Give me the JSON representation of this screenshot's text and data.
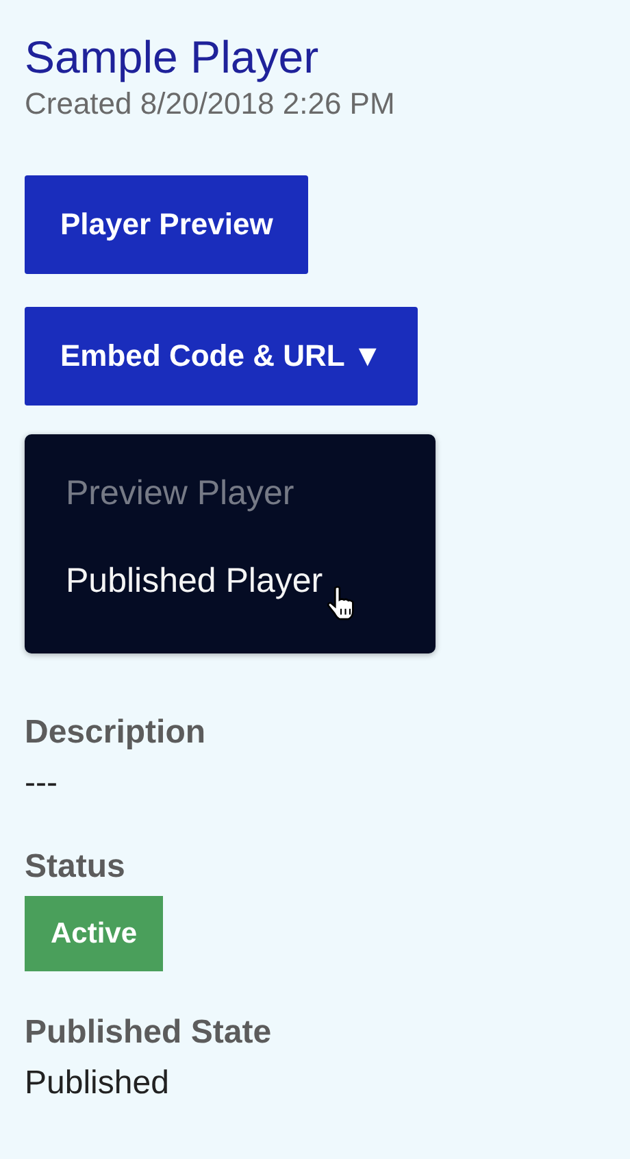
{
  "header": {
    "title": "Sample Player",
    "created": "Created 8/20/2018 2:26 PM"
  },
  "buttons": [
    {
      "label": "Player Preview"
    },
    {
      "label": "Embed Code & URL ▼"
    }
  ],
  "dropdown": {
    "items": [
      {
        "label": "Preview Player",
        "disabled": true,
        "hovered": false
      },
      {
        "label": "Published Player",
        "disabled": false,
        "hovered": true
      }
    ]
  },
  "fields": [
    {
      "label": "Description",
      "value": "---",
      "kind": "text"
    },
    {
      "label": "Status",
      "value": "Active",
      "kind": "badge"
    },
    {
      "label": "Published State",
      "value": "Published",
      "kind": "text"
    }
  ]
}
